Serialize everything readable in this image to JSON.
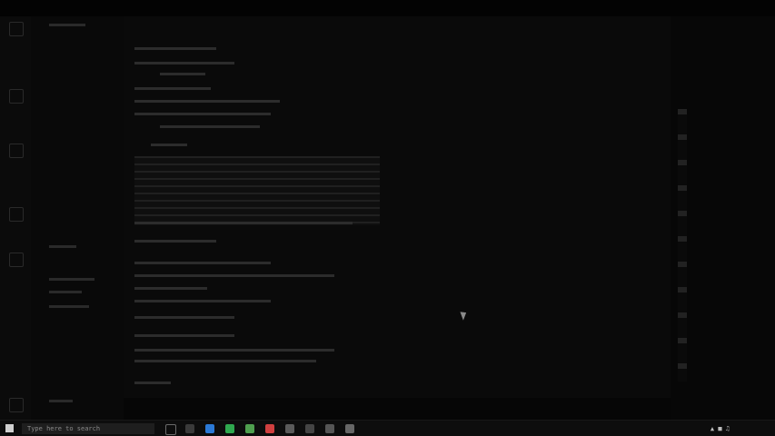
{
  "taskbar": {
    "search_placeholder": "Type here to search",
    "clock_time": "",
    "clock_date": ""
  },
  "editor": {
    "active_tab": "",
    "lines": []
  },
  "colors": {
    "background": "#060606",
    "taskbar": "#0d0d0d",
    "text": "#9a9a9a",
    "accent_green": "#2fa84f",
    "accent_blue": "#2b79d6",
    "accent_red": "#d04040"
  },
  "icons": {
    "start": "windows-start-icon",
    "search": "search-icon",
    "task_view": "task-view-icon",
    "cursor": "mouse-pointer-icon"
  }
}
